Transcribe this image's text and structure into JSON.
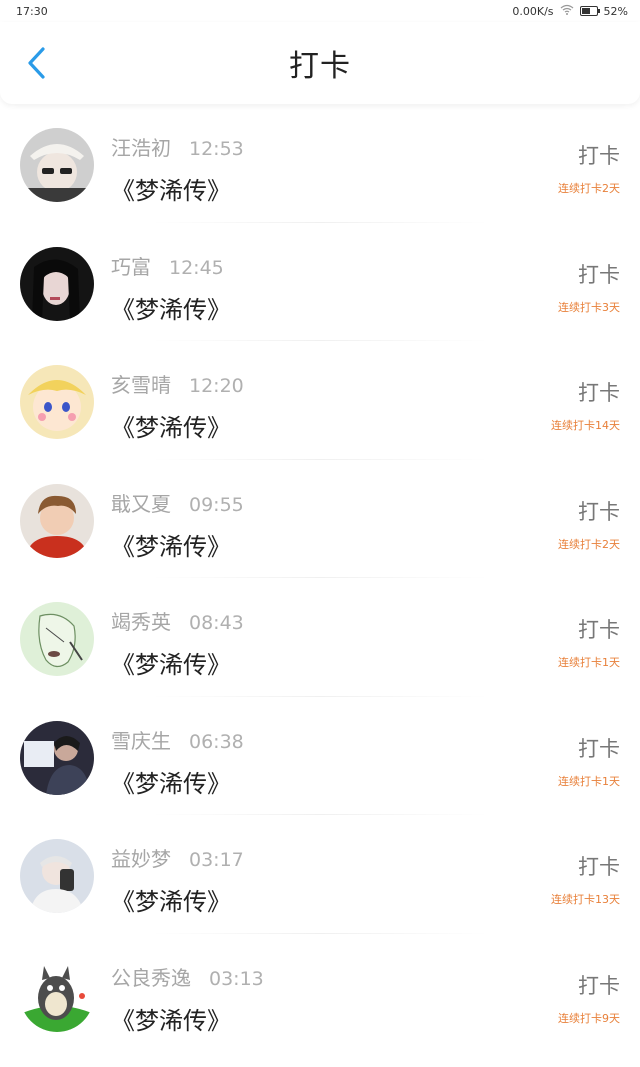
{
  "status": {
    "time": "17:30",
    "speed": "0.00K/s",
    "battery": "52%",
    "battery_level": 0.52,
    "icons": [
      "wifi-icon",
      "battery-icon"
    ]
  },
  "header": {
    "title": "打卡",
    "back_icon": "back-chevron-icon",
    "accent": "#2a9be8"
  },
  "colors": {
    "streak": "#e8803a"
  },
  "items": [
    {
      "name": "汪浩初",
      "time": "12:53",
      "book": "《梦浠传》",
      "action": "打卡",
      "streak": "连续打卡2天"
    },
    {
      "name": "巧富",
      "time": "12:45",
      "book": "《梦浠传》",
      "action": "打卡",
      "streak": "连续打卡3天"
    },
    {
      "name": "亥雪晴",
      "time": "12:20",
      "book": "《梦浠传》",
      "action": "打卡",
      "streak": "连续打卡14天"
    },
    {
      "name": "戢又夏",
      "time": "09:55",
      "book": "《梦浠传》",
      "action": "打卡",
      "streak": "连续打卡2天"
    },
    {
      "name": "竭秀英",
      "time": "08:43",
      "book": "《梦浠传》",
      "action": "打卡",
      "streak": "连续打卡1天"
    },
    {
      "name": "雪庆生",
      "time": "06:38",
      "book": "《梦浠传》",
      "action": "打卡",
      "streak": "连续打卡1天"
    },
    {
      "name": "益妙梦",
      "time": "03:17",
      "book": "《梦浠传》",
      "action": "打卡",
      "streak": "连续打卡13天"
    },
    {
      "name": "公良秀逸",
      "time": "03:13",
      "book": "《梦浠传》",
      "action": "打卡",
      "streak": "连续打卡9天"
    }
  ]
}
